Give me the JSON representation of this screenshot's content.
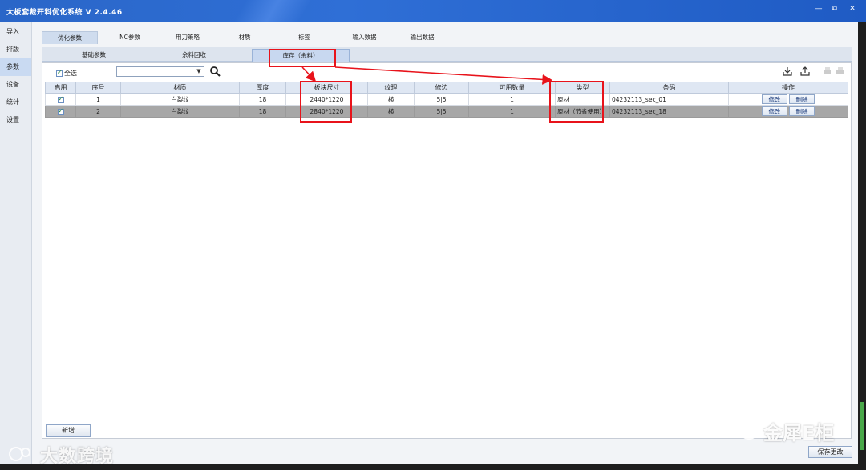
{
  "window": {
    "title": "大板套裁开料优化系统 V 2.4.46",
    "min": "—",
    "max": "⧉",
    "close": "✕"
  },
  "sidebar": {
    "items": [
      {
        "label": "导入"
      },
      {
        "label": "排版"
      },
      {
        "label": "参数",
        "active": true
      },
      {
        "label": "设备"
      },
      {
        "label": "统计"
      },
      {
        "label": "设置"
      }
    ]
  },
  "tabs_top": [
    {
      "label": "优化参数",
      "active": true
    },
    {
      "label": "NC参数"
    },
    {
      "label": "用刀策略"
    },
    {
      "label": "材质"
    },
    {
      "label": "标签"
    },
    {
      "label": "输入数据"
    },
    {
      "label": "输出数据"
    }
  ],
  "tabs_sub": [
    {
      "label": "基础参数"
    },
    {
      "label": "余料回收"
    },
    {
      "label": "库存（余料）",
      "active": true
    }
  ],
  "toolbar": {
    "select_all": "全选",
    "filter_value": ""
  },
  "table": {
    "headers": [
      "启用",
      "序号",
      "材质",
      "厚度",
      "板块尺寸",
      "纹理",
      "修边",
      "可用数量",
      "类型",
      "条码",
      "操作"
    ],
    "rows": [
      {
        "enabled": true,
        "index": "1",
        "material": "白裂纹",
        "thickness": "18",
        "size": "2440*1220",
        "grain": "横",
        "trim": "5|5",
        "qty": "1",
        "type": "原材",
        "barcode": "04232113_sec_01",
        "edit": "修改",
        "delete": "删除"
      },
      {
        "enabled": true,
        "index": "2",
        "material": "白裂纹",
        "thickness": "18",
        "size": "2840*1220",
        "grain": "横",
        "trim": "5|5",
        "qty": "1",
        "type": "原材（节省使用）",
        "barcode": "04232113_sec_18",
        "edit": "修改",
        "delete": "删除"
      }
    ]
  },
  "buttons": {
    "add": "新增",
    "save": "保存更改"
  },
  "watermarks": {
    "left": "大数跨境",
    "right": "金犀E柜"
  },
  "colors": {
    "titlebar": "#2a66c8",
    "highlight_box": "#e8131b",
    "selected_row": "#a7a7a7",
    "type_save": "#22a030"
  }
}
